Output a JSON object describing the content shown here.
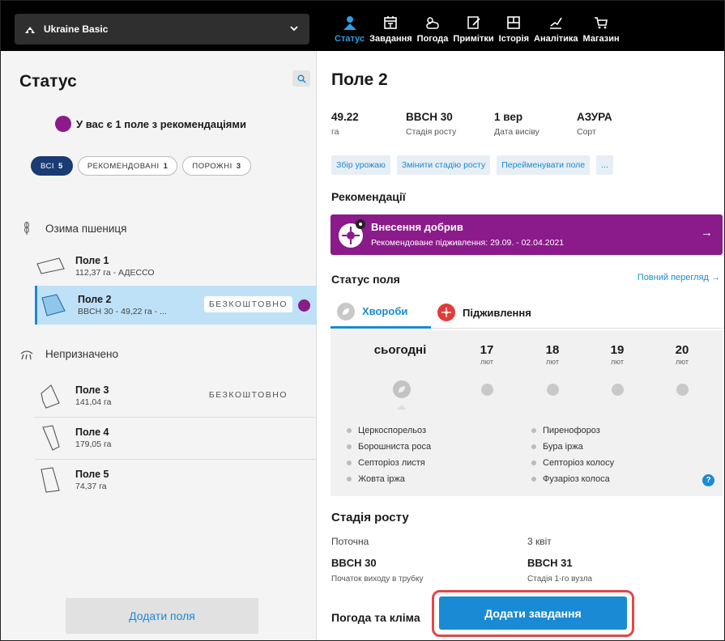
{
  "topbar": {
    "farm_name": "Ukraine Basic",
    "tabs": [
      {
        "label": "Статус",
        "icon": "status-icon"
      },
      {
        "label": "Завдання",
        "icon": "calendar-icon"
      },
      {
        "label": "Погода",
        "icon": "weather-icon"
      },
      {
        "label": "Примітки",
        "icon": "notes-icon"
      },
      {
        "label": "Історія",
        "icon": "history-icon"
      },
      {
        "label": "Аналітика",
        "icon": "analytics-icon"
      },
      {
        "label": "Магазин",
        "icon": "cart-icon"
      }
    ],
    "active_tab": 0
  },
  "left": {
    "title": "Статус",
    "recommendation_text": "У вас є 1 поле з рекомендаціями",
    "filters": [
      {
        "label": "ВСІ",
        "count": "5"
      },
      {
        "label": "РЕКОМЕНДОВАНІ",
        "count": "1"
      },
      {
        "label": "ПОРОЖНІ",
        "count": "3"
      }
    ],
    "groups": [
      {
        "label": "Озима пшениця",
        "icon": "wheat-icon"
      },
      {
        "label": "Непризначено",
        "icon": "unassigned-icon"
      }
    ],
    "fields": [
      {
        "name": "Поле 1",
        "sub": "112,37 га - АДЕССО",
        "badge": ""
      },
      {
        "name": "Поле 2",
        "sub": "BBCH 30 - 49,22 га - ...",
        "badge": "БЕЗКОШТОВНО"
      },
      {
        "name": "Поле 3",
        "sub": "141,04 га",
        "badge": "БЕЗКОШТОВНО"
      },
      {
        "name": "Поле 4",
        "sub": "179,05 га",
        "badge": ""
      },
      {
        "name": "Поле 5",
        "sub": "74,37 га",
        "badge": ""
      }
    ],
    "add_fields_label": "Додати поля"
  },
  "right": {
    "title": "Поле 2",
    "stats": [
      {
        "value": "49.22",
        "label": "га"
      },
      {
        "value": "BBCH 30",
        "label": "Стадія росту"
      },
      {
        "value": "1 вер",
        "label": "Дата висіву"
      },
      {
        "value": "АЗУРА",
        "label": "Сорт"
      }
    ],
    "actions": [
      "Збір урожаю",
      "Змінити стадію росту",
      "Перейменувати поле",
      "..."
    ],
    "recommendations_title": "Рекомендації",
    "banner": {
      "title": "Внесення добрив",
      "subtitle": "Рекомендоване підживлення: 29.09. - 02.04.2021"
    },
    "field_status_title": "Статус поля",
    "full_view_label": "Повний перегляд →",
    "status_tabs": [
      "Хвороби",
      "Підживлення"
    ],
    "days": [
      {
        "day": "сьогодні",
        "month": ""
      },
      {
        "day": "17",
        "month": "лют"
      },
      {
        "day": "18",
        "month": "лют"
      },
      {
        "day": "19",
        "month": "лют"
      },
      {
        "day": "20",
        "month": "лют"
      }
    ],
    "diseases": [
      "Церкоспорельоз",
      "Пиренофороз",
      "Борошниста роса",
      "Бура іржа",
      "Септоріоз листя",
      "Септоріоз колосу",
      "Жовта іржа",
      "Фузаріоз колоса"
    ],
    "growth_title": "Стадія росту",
    "growth": {
      "current_label": "Поточна",
      "current_value": "BBCH 30",
      "current_desc": "Початок виходу в трубку",
      "next_label": "3 квіт",
      "next_value": "BBCH 31",
      "next_desc": "Стадія 1-го вузла"
    },
    "weather_title": "Погода та кліма",
    "add_task_label": "Додати завдання"
  },
  "colors": {
    "accent": "#1a8ad4",
    "purple": "#8b1a8a",
    "selected_row": "#bfe1f7",
    "highlight_border": "#e04848"
  }
}
